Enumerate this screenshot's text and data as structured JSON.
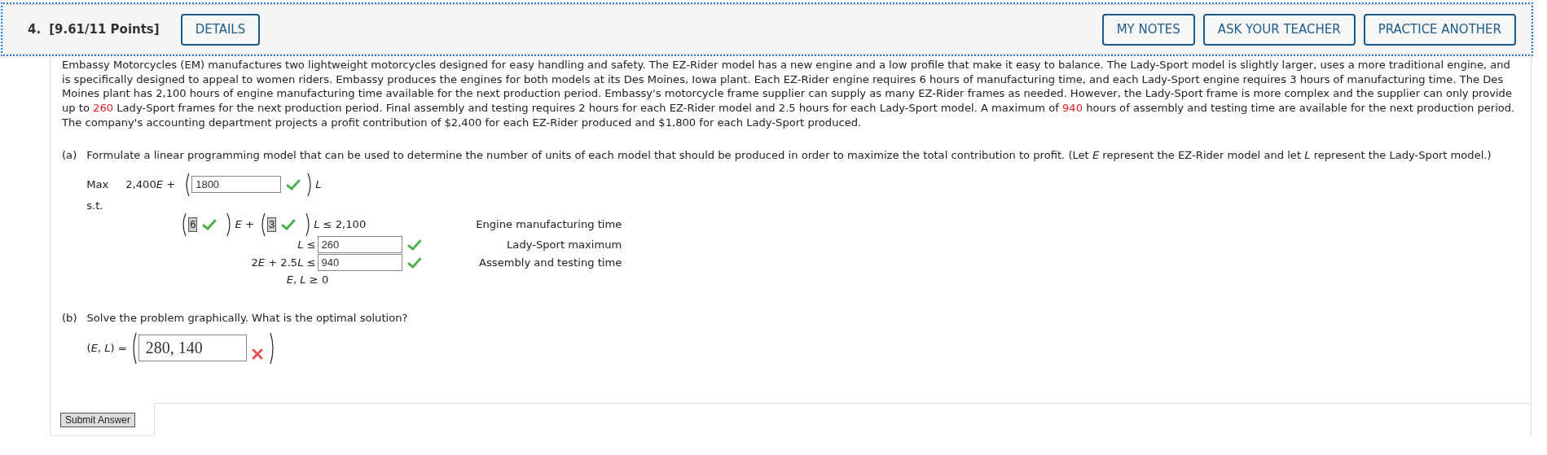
{
  "header": {
    "number": "4.",
    "points": "[9.61/11 Points]",
    "details_button": "DETAILS",
    "buttons": [
      "MY NOTES",
      "ASK YOUR TEACHER",
      "PRACTICE ANOTHER"
    ]
  },
  "problem": [
    {
      "text": "Embassy Motorcycles (EM) manufactures two lightweight motorcycles designed for easy handling and safety. The EZ-Rider model has a new engine and a low profile that make it easy to balance. The Lady-Sport model is slightly larger, uses a more traditional engine, and is specifically designed to appeal to women riders. Embassy produces the engines for both models at its Des Moines, Iowa plant. Each EZ-Rider engine requires 6 hours of manufacturing time, and each Lady-Sport engine requires 3 hours of manufacturing time. The Des Moines plant has 2,100 hours of engine manufacturing time available for the next production period. Embassy's motorcycle frame supplier can supply as many EZ-Rider frames as needed. However, the Lady-Sport frame is more complex and the supplier can only provide up to ",
      "highlight": false
    },
    {
      "text": "260",
      "highlight": true
    },
    {
      "text": " Lady-Sport frames for the next production period. Final assembly and testing requires 2 hours for each EZ-Rider model and 2.5 hours for each Lady-Sport model. A maximum of ",
      "highlight": false
    },
    {
      "text": "940",
      "highlight": true
    },
    {
      "text": " hours of assembly and testing time are available for the next production period. The company's accounting department projects a profit contribution of $2,400 for each EZ-Rider produced and $1,800 for each Lady-Sport produced.",
      "highlight": false
    }
  ],
  "part_a": {
    "label": "(a)",
    "prompt": "Formulate a linear programming model that can be used to determine the number of units of each model that should be produced in order to maximize the total contribution to profit. (Let *E* represent the EZ-Rider model and let *L* represent the Lady-Sport model.)",
    "objective": {
      "label": "Max",
      "prefix": [
        {
          "text": "2,400"
        },
        {
          "text": "E",
          "italic": true
        },
        {
          "text": " +"
        }
      ],
      "value": "1800",
      "correct": true,
      "suffix": [
        {
          "text": "L",
          "italic": true
        }
      ]
    },
    "st_label": "s.t.",
    "constraints": [
      {
        "kind": "coefficients",
        "terms": [
          {
            "value": "6",
            "correct": true,
            "after": [
              {
                "text": "E",
                "italic": true
              },
              {
                "text": " +"
              }
            ]
          },
          {
            "value": "3",
            "correct": true,
            "after": [
              {
                "text": "L",
                "italic": true
              },
              {
                "text": " ≤ 2,100"
              }
            ]
          }
        ],
        "description": "Engine manufacturing time"
      },
      {
        "kind": "input",
        "lhs": [
          {
            "text": "L",
            "italic": true
          },
          {
            "text": " ≤"
          }
        ],
        "value": "260",
        "correct": true,
        "description": "Lady-Sport maximum"
      },
      {
        "kind": "input",
        "lhs": [
          {
            "text": "2"
          },
          {
            "text": "E",
            "italic": true
          },
          {
            "text": " + 2.5"
          },
          {
            "text": "L",
            "italic": true
          },
          {
            "text": " ≤"
          }
        ],
        "value": "940",
        "correct": true,
        "description": "Assembly and testing time"
      },
      {
        "kind": "text",
        "lhs": [
          {
            "text": "E",
            "italic": true
          },
          {
            "text": ", "
          },
          {
            "text": "L",
            "italic": true
          },
          {
            "text": " ≥ 0"
          }
        ]
      }
    ]
  },
  "part_b": {
    "label": "(b)",
    "prompt": "Solve the problem graphically. What is the optimal solution?",
    "lhs": [
      {
        "text": "("
      },
      {
        "text": "E",
        "italic": true
      },
      {
        "text": ", "
      },
      {
        "text": "L",
        "italic": true
      },
      {
        "text": ") ="
      }
    ],
    "value": "280, 140",
    "correct": false
  },
  "submit": "Submit Answer"
}
